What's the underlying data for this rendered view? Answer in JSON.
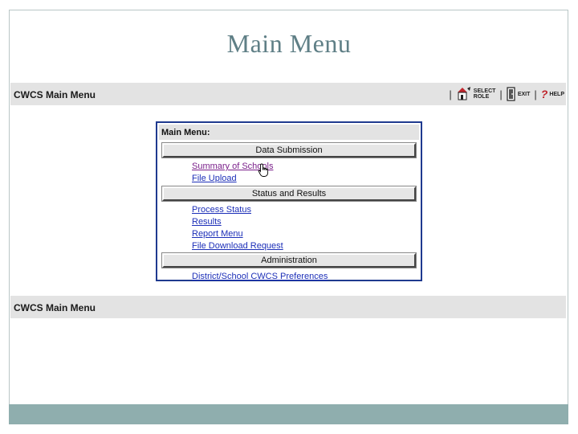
{
  "slide": {
    "title": "Main Menu"
  },
  "app_bar": {
    "title": "CWCS Main Menu",
    "toolbar": {
      "separator": "|",
      "select_role_top": "SELECT",
      "select_role_bottom": "ROLE",
      "exit_label": "EXIT",
      "help_mark": "?",
      "help_label": "HELP"
    }
  },
  "menu": {
    "header": "Main Menu:",
    "sections": [
      {
        "title": "Data Submission",
        "links": [
          "Summary of Schools",
          "File Upload"
        ]
      },
      {
        "title": "Status and Results",
        "links": [
          "Process Status",
          "Results",
          "Report Menu",
          "File Download Request"
        ]
      },
      {
        "title": "Administration",
        "links": [
          "District/School CWCS Preferences"
        ]
      }
    ]
  },
  "footer_bar": {
    "title": "CWCS Main Menu"
  },
  "colors": {
    "link": "#1c2fb8",
    "visited_link": "#7a1f8a",
    "panel_border": "#1f3a8f",
    "title": "#5f7f86",
    "footer_band": "#8faeae"
  }
}
